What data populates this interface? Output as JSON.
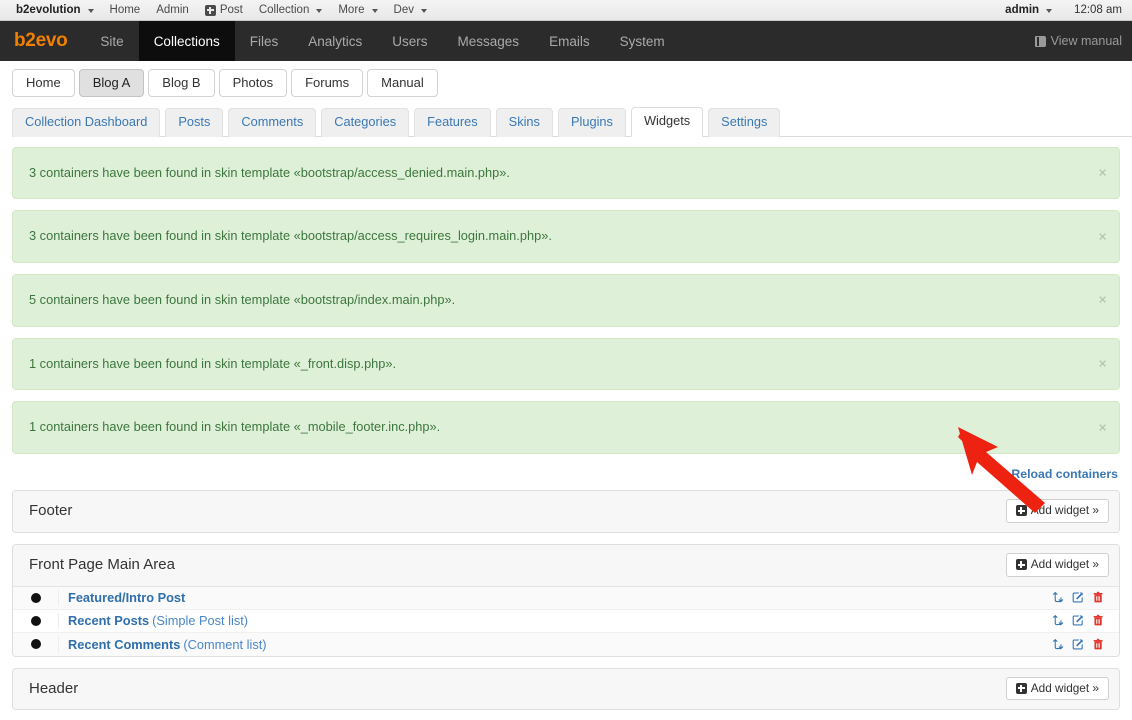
{
  "evobar": {
    "brand": "b2evolution",
    "items": [
      {
        "label": "Home",
        "caret": false,
        "icon": null
      },
      {
        "label": "Admin",
        "caret": false,
        "icon": null
      },
      {
        "label": "Post",
        "caret": false,
        "icon": "plus-square-icon"
      },
      {
        "label": "Collection",
        "caret": true,
        "icon": null
      },
      {
        "label": "More",
        "caret": true,
        "icon": null
      },
      {
        "label": "Dev",
        "caret": true,
        "icon": null
      }
    ],
    "user": "admin",
    "time": "12:08 am"
  },
  "mainnav": {
    "logo": "b2evo",
    "items": [
      {
        "label": "Site",
        "active": false
      },
      {
        "label": "Collections",
        "active": true
      },
      {
        "label": "Files",
        "active": false
      },
      {
        "label": "Analytics",
        "active": false
      },
      {
        "label": "Users",
        "active": false
      },
      {
        "label": "Messages",
        "active": false
      },
      {
        "label": "Emails",
        "active": false
      },
      {
        "label": "System",
        "active": false
      }
    ],
    "manual_label": "View manual"
  },
  "collection_tabs": [
    {
      "label": "Home",
      "active": false
    },
    {
      "label": "Blog A",
      "active": true
    },
    {
      "label": "Blog B",
      "active": false
    },
    {
      "label": "Photos",
      "active": false
    },
    {
      "label": "Forums",
      "active": false
    },
    {
      "label": "Manual",
      "active": false
    }
  ],
  "sub_tabs": [
    {
      "label": "Collection Dashboard",
      "active": false
    },
    {
      "label": "Posts",
      "active": false
    },
    {
      "label": "Comments",
      "active": false
    },
    {
      "label": "Categories",
      "active": false
    },
    {
      "label": "Features",
      "active": false
    },
    {
      "label": "Skins",
      "active": false
    },
    {
      "label": "Plugins",
      "active": false
    },
    {
      "label": "Widgets",
      "active": true
    },
    {
      "label": "Settings",
      "active": false
    }
  ],
  "alerts": [
    {
      "text": "3 containers have been found in skin template «bootstrap/access_denied.main.php».",
      "close": "×"
    },
    {
      "text": "3 containers have been found in skin template «bootstrap/access_requires_login.main.php».",
      "close": "×"
    },
    {
      "text": "5 containers have been found in skin template «bootstrap/index.main.php».",
      "close": "×"
    },
    {
      "text": "1 containers have been found in skin template «_front.disp.php».",
      "close": "×"
    },
    {
      "text": "1 containers have been found in skin template «_mobile_footer.inc.php».",
      "close": "×"
    }
  ],
  "reload": {
    "label": "Reload containers",
    "icon": "refresh-icon"
  },
  "add_widget_label": "Add widget »",
  "panels": [
    {
      "title": "Footer",
      "widgets": []
    },
    {
      "title": "Front Page Main Area",
      "widgets": [
        {
          "name": "Featured/Intro Post",
          "type": ""
        },
        {
          "name": "Recent Posts",
          "type": "(Simple Post list)"
        },
        {
          "name": "Recent Comments",
          "type": "(Comment list)"
        }
      ]
    },
    {
      "title": "Header",
      "widgets": []
    }
  ],
  "row_actions": [
    "reorder-icon",
    "edit-icon",
    "delete-icon"
  ],
  "colors": {
    "brand_orange": "#f08000",
    "nav_dark": "#2b2b2b",
    "nav_active": "#0d0d0d",
    "link_blue": "#3a78b5",
    "alert_bg": "#dff0d8",
    "alert_text": "#3c763d",
    "delete_red": "#e03a30",
    "annotation_red": "#ee2211"
  }
}
